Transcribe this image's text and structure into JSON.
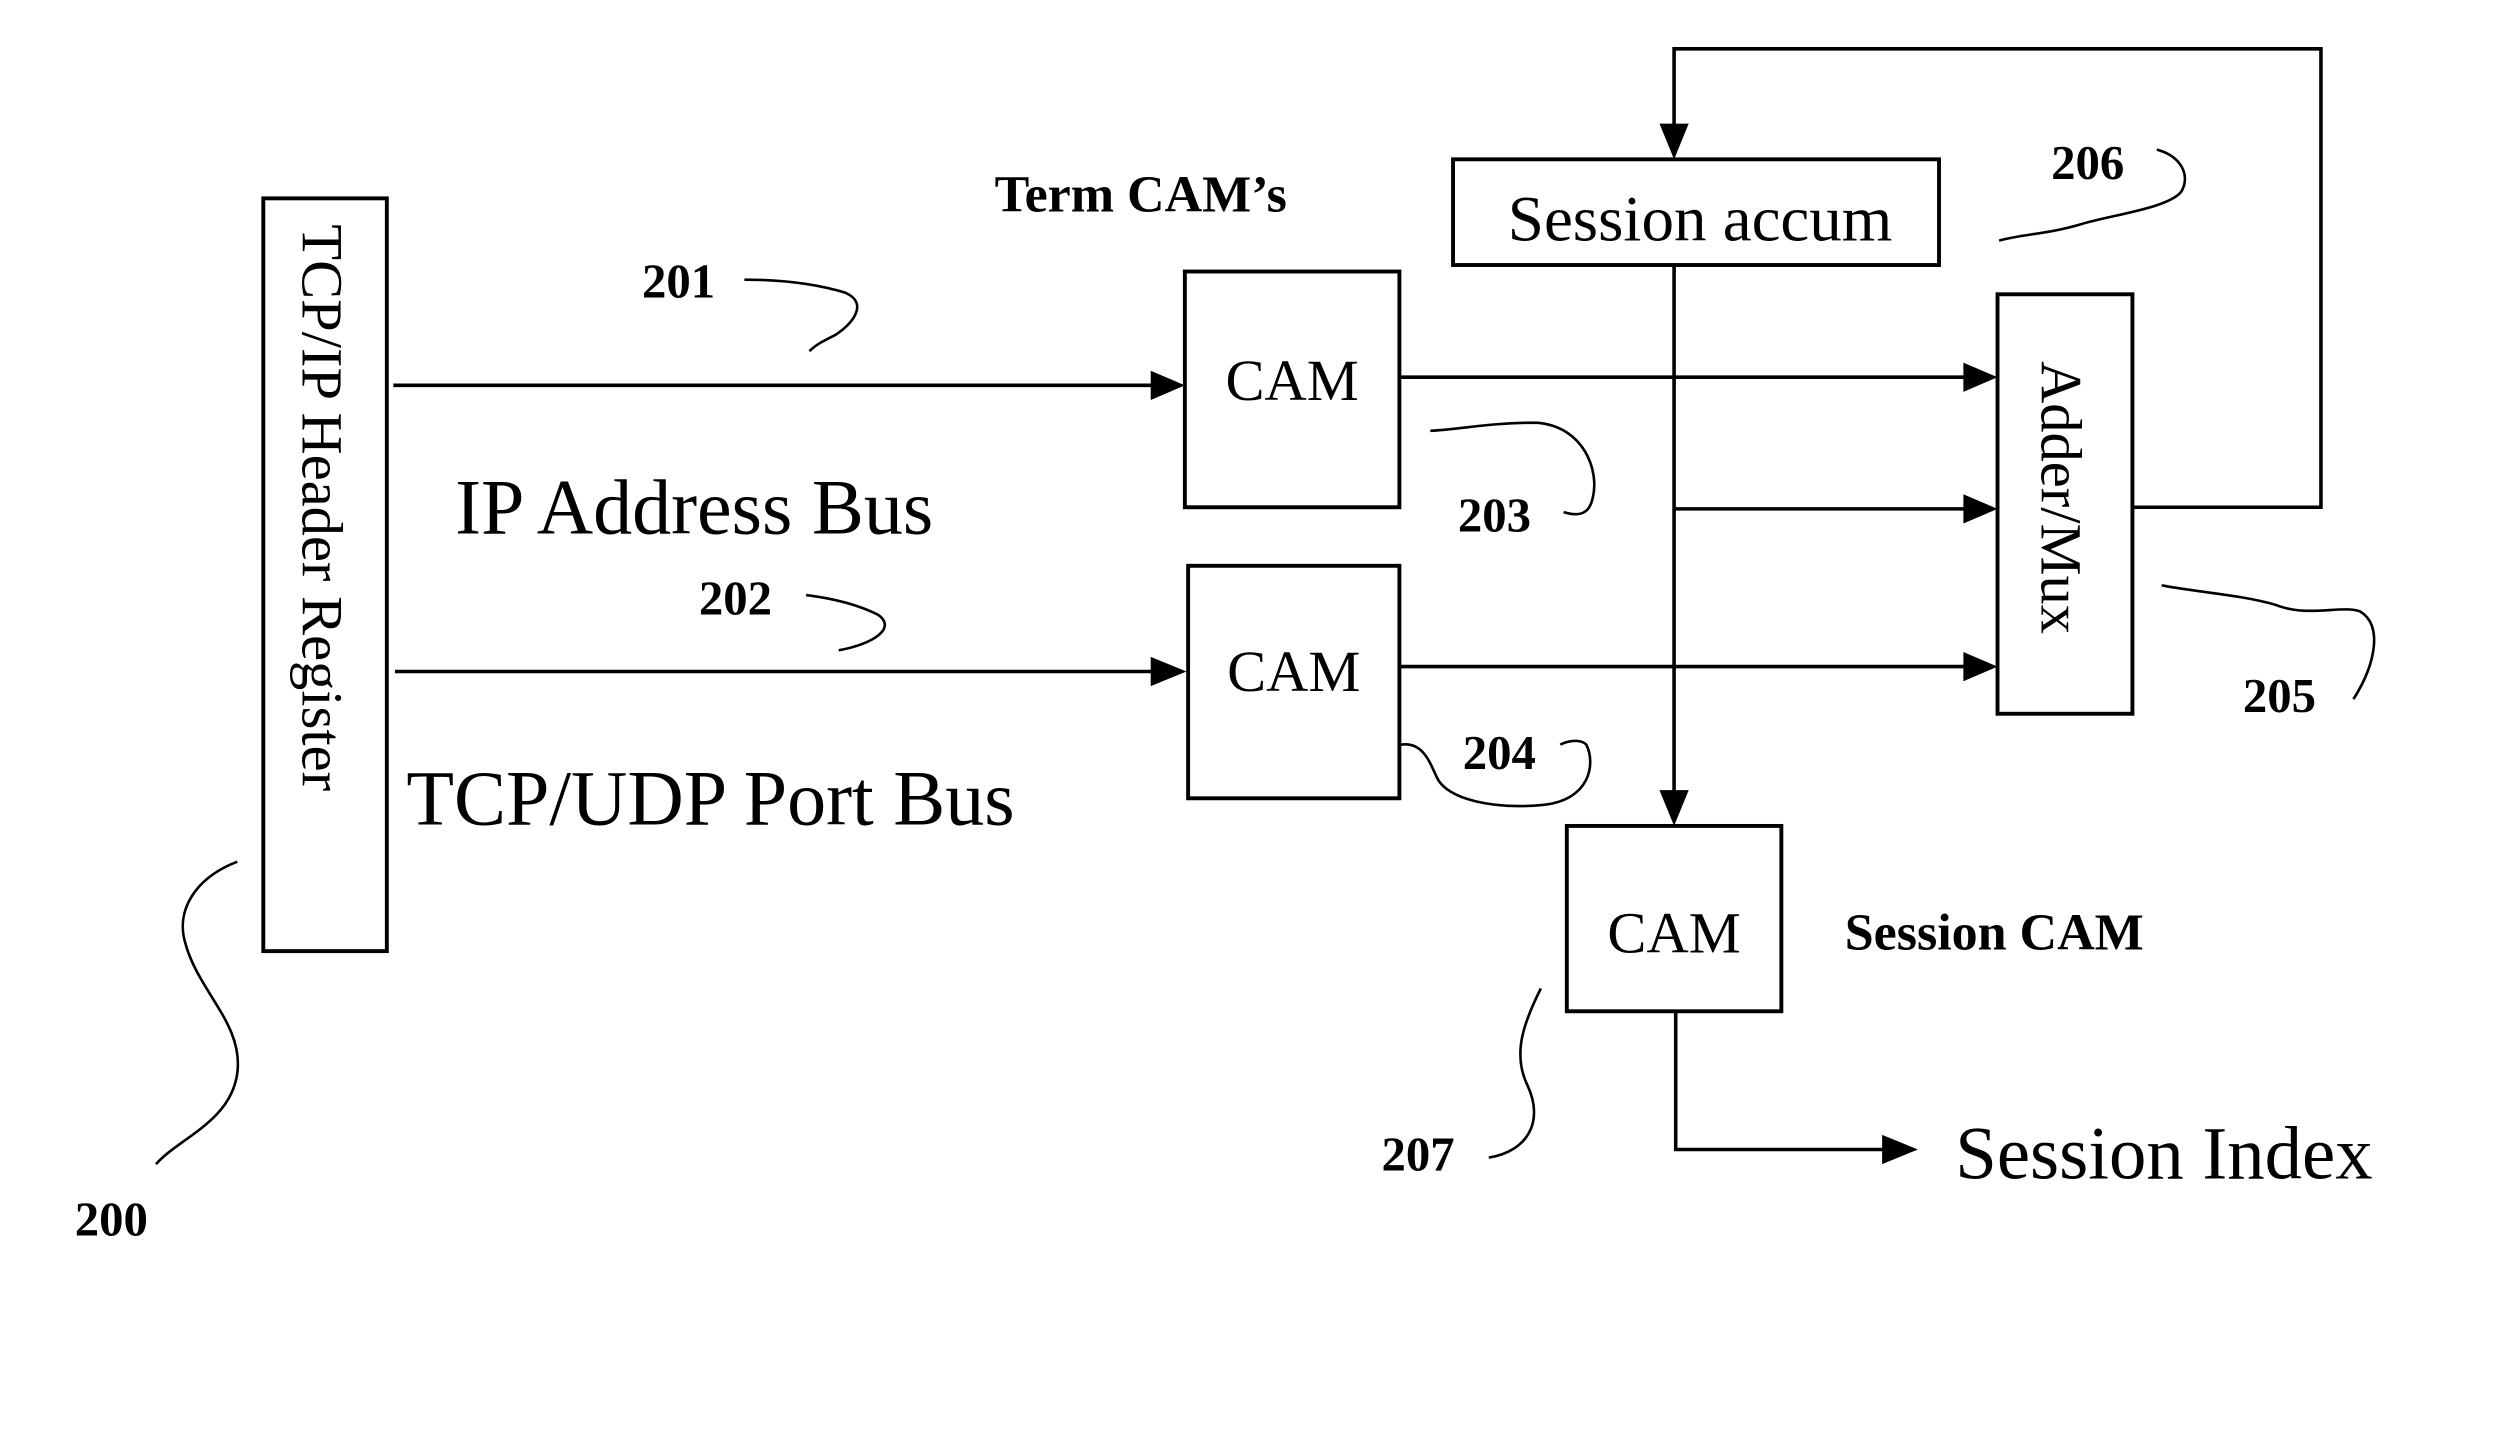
{
  "figure": {
    "blocks": {
      "header_register": "TCP/IP Header Register",
      "term_cam_1": "CAM",
      "term_cam_2": "CAM",
      "session_accum": "Session accum",
      "adder_mux": "Adder/Mux",
      "session_cam": "CAM"
    },
    "captions": {
      "term_cams": "Term CAM’s",
      "session_cam": "Session CAM",
      "ip_address_bus": "IP Address Bus",
      "tcp_udp_port_bus": "TCP/UDP Port Bus",
      "session_index": "Session Index"
    },
    "reference_numerals": {
      "header_register": "200",
      "ip_address_bus": "201",
      "tcp_udp_port_bus": "202",
      "term_cam_1": "203",
      "term_cam_2": "204",
      "adder_mux": "205",
      "session_accum": "206",
      "session_cam": "207"
    },
    "colors": {
      "ink": "#000000",
      "paper": "#ffffff"
    }
  }
}
